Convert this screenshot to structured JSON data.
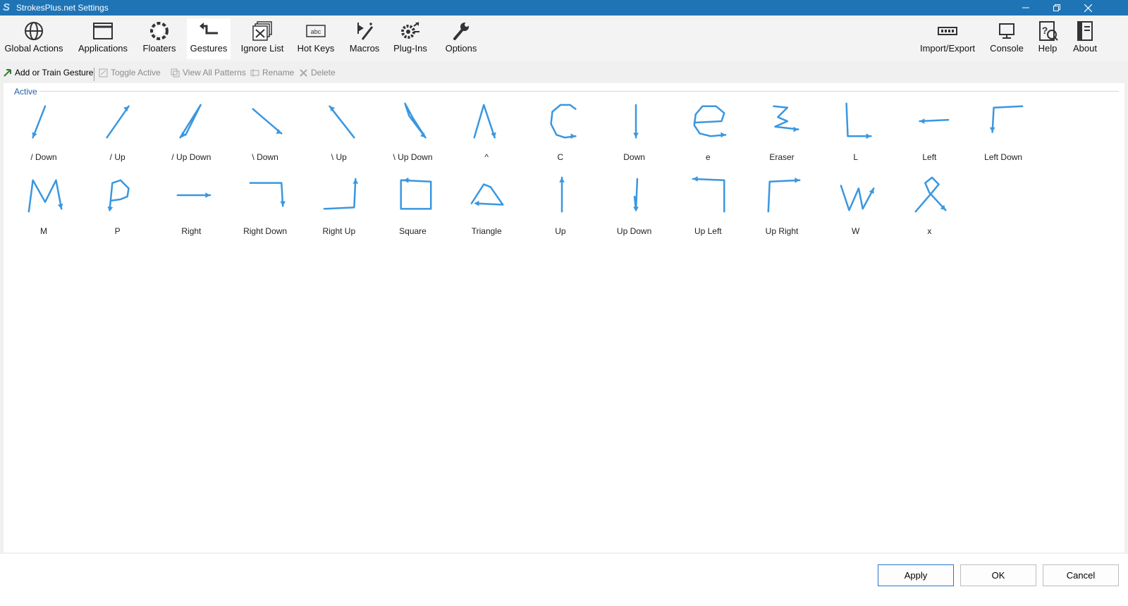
{
  "window": {
    "title": "StrokesPlus.net Settings",
    "accent": "#1f74b6"
  },
  "toolbar": {
    "left": [
      {
        "label": "Global Actions",
        "icon": "globe-icon"
      },
      {
        "label": "Applications",
        "icon": "window-icon"
      },
      {
        "label": "Floaters",
        "icon": "floaters-icon"
      },
      {
        "label": "Gestures",
        "icon": "gesture-arrow-icon",
        "active": true
      },
      {
        "label": "Ignore List",
        "icon": "ignore-list-icon"
      },
      {
        "label": "Hot Keys",
        "icon": "hotkey-icon"
      },
      {
        "label": "Macros",
        "icon": "macro-wand-icon"
      },
      {
        "label": "Plug-Ins",
        "icon": "plugin-gear-icon"
      },
      {
        "label": "Options",
        "icon": "wrench-icon"
      }
    ],
    "right": [
      {
        "label": "Import/Export",
        "icon": "import-export-icon"
      },
      {
        "label": "Console",
        "icon": "monitor-icon"
      },
      {
        "label": "Help",
        "icon": "help-icon"
      },
      {
        "label": "About",
        "icon": "about-icon"
      }
    ]
  },
  "subtoolbar": {
    "add": "Add or Train Gesture",
    "toggle": "Toggle Active",
    "view_all": "View All Patterns",
    "rename": "Rename",
    "delete": "Delete"
  },
  "group": {
    "label": "Active"
  },
  "gestures": [
    "/ Down",
    "/ Up",
    "/ Up Down",
    "\\ Down",
    "\\ Up",
    "\\ Up Down",
    "^",
    "C",
    "Down",
    "e",
    "Eraser",
    "L",
    "Left",
    "Left Down",
    "M",
    "P",
    "Right",
    "Right Down",
    "Right Up",
    "Square",
    "Triangle",
    "Up",
    "Up Down",
    "Up Left",
    "Up Right",
    "W",
    "x"
  ],
  "gesture_color": "#3a97e0",
  "buttons": {
    "apply": "Apply",
    "ok": "OK",
    "cancel": "Cancel"
  }
}
